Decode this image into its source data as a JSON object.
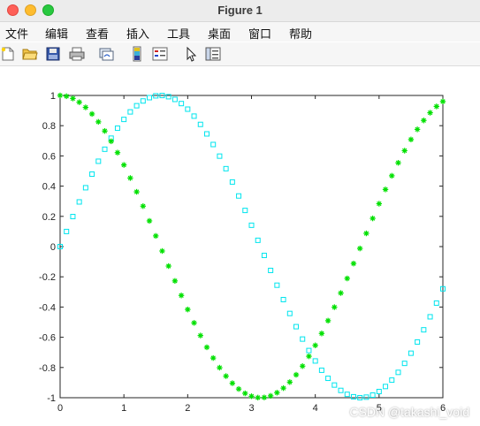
{
  "window": {
    "title": "Figure 1"
  },
  "menu": {
    "items": [
      {
        "label": "文件"
      },
      {
        "label": "编辑"
      },
      {
        "label": "查看"
      },
      {
        "label": "插入"
      },
      {
        "label": "工具"
      },
      {
        "label": "桌面"
      },
      {
        "label": "窗口"
      },
      {
        "label": "帮助"
      }
    ]
  },
  "toolbar": {
    "tools": [
      {
        "icon": "new-figure-icon"
      },
      {
        "icon": "open-file-icon"
      },
      {
        "icon": "save-icon"
      },
      {
        "icon": "print-icon"
      },
      {
        "icon": "link-plot-icon"
      },
      {
        "icon": "insert-colorbar-icon"
      },
      {
        "icon": "insert-legend-icon"
      },
      {
        "icon": "pointer-icon"
      },
      {
        "icon": "show-plot-tools-icon"
      }
    ]
  },
  "watermark": "CSDN @takashi_void",
  "chart_data": {
    "type": "scatter",
    "xlim": [
      0,
      6
    ],
    "ylim": [
      -1,
      1
    ],
    "xticks": [
      "0",
      "1",
      "2",
      "3",
      "4",
      "5",
      "6"
    ],
    "yticks": [
      "-1",
      "-0.8",
      "-0.6",
      "-0.4",
      "-0.2",
      "0",
      "0.2",
      "0.4",
      "0.6",
      "0.8",
      "1"
    ],
    "grid": false,
    "legend": "none",
    "series": [
      {
        "function": "sin",
        "marker": "square",
        "color": "#00e5ee",
        "x_start": 0,
        "x_end": 6,
        "step": 0.1
      },
      {
        "function": "cos",
        "marker": "asterisk",
        "color": "#00e000",
        "x_start": 0,
        "x_end": 6,
        "step": 0.1
      }
    ]
  }
}
